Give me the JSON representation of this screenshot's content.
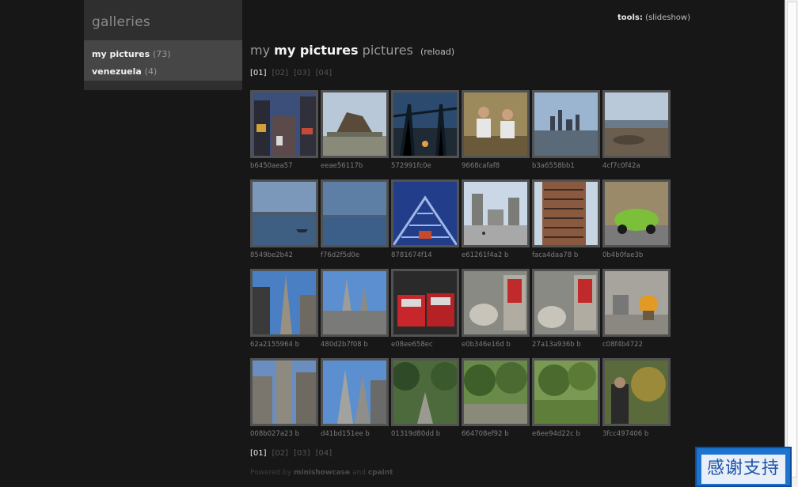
{
  "sidebar": {
    "title": "galleries",
    "items": [
      {
        "name": "my pictures",
        "count": "(73)"
      },
      {
        "name": "venezuela",
        "count": "(4)"
      }
    ]
  },
  "tools": {
    "label": "tools:",
    "link": "(slideshow)"
  },
  "heading": {
    "pre": "my",
    "strong": "my pictures",
    "post": "pictures",
    "reload": "(reload)"
  },
  "pager": {
    "pages": [
      "[01]",
      "[02]",
      "[03]",
      "[04]"
    ],
    "active_index": 0
  },
  "thumbnails": [
    {
      "caption": "b6450aea57",
      "icon": "times-square-photo"
    },
    {
      "caption": "eeae56117b",
      "icon": "sculpture-photo"
    },
    {
      "caption": "572991fc0e",
      "icon": "bridge-dusk-photo"
    },
    {
      "caption": "9668cafaf8",
      "icon": "people-bench-photo"
    },
    {
      "caption": "b3a6558bb1",
      "icon": "skyline-water-photo"
    },
    {
      "caption": "4cf7c0f42a",
      "icon": "rocky-shore-photo"
    },
    {
      "caption": "8549be2b42",
      "icon": "harbor-boat-photo"
    },
    {
      "caption": "f76d2f5d0e",
      "icon": "hazy-harbor-photo"
    },
    {
      "caption": "8781674f14",
      "icon": "blue-bridge-photo"
    },
    {
      "caption": "e61261f4a2 b",
      "icon": "plaza-church-photo"
    },
    {
      "caption": "faca4daa78 b",
      "icon": "brick-building-photo"
    },
    {
      "caption": "0b4b0fae3b",
      "icon": "green-beetle-photo"
    },
    {
      "caption": "62a2155964 b",
      "icon": "skyscraper-photo"
    },
    {
      "caption": "480d2b7f08 b",
      "icon": "cathedral-spires-photo"
    },
    {
      "caption": "e08ee658ec",
      "icon": "fire-truck-photo"
    },
    {
      "caption": "e0b346e16d b",
      "icon": "library-lion-photo"
    },
    {
      "caption": "27a13a936b b",
      "icon": "library-lion-photo-2"
    },
    {
      "caption": "c08f4b4722",
      "icon": "library-steps-photo"
    },
    {
      "caption": "008b027a23 b",
      "icon": "rockefeller-photo"
    },
    {
      "caption": "d41bd151ee b",
      "icon": "cathedral-spires-photo-2"
    },
    {
      "caption": "01319d80dd b",
      "icon": "park-path-photo"
    },
    {
      "caption": "664708ef92 b",
      "icon": "park-trees-photo"
    },
    {
      "caption": "e6ee94d22c b",
      "icon": "park-lawn-photo"
    },
    {
      "caption": "3fcc497406 b",
      "icon": "photographer-park-photo"
    }
  ],
  "footer": {
    "prefix": "Powered by",
    "brand1": "minishowcase",
    "and": "and",
    "brand2": "cpaint"
  },
  "badge": {
    "text": "感谢支持"
  }
}
